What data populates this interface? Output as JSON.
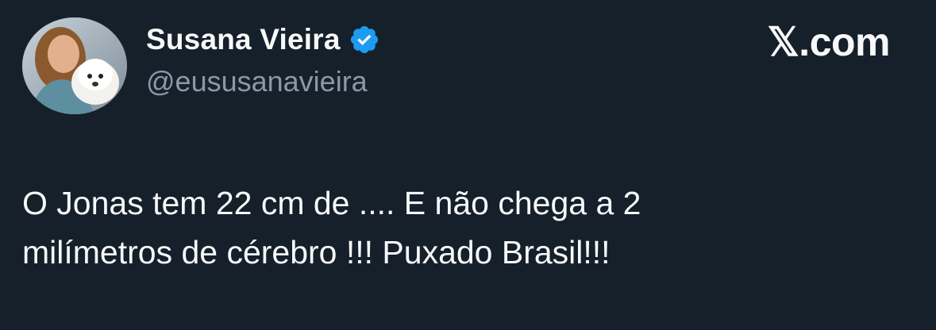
{
  "tweet": {
    "author": {
      "display_name": "Susana Vieira",
      "handle": "@eususanavieira",
      "verified": true,
      "avatar_icon": "profile-photo-with-dog"
    },
    "brand": "𝕏.com",
    "text_lines": [
      "O Jonas tem 22 cm de .... E não chega a 2",
      "milímetros de cérebro !!! Puxado Brasil!!!"
    ]
  },
  "colors": {
    "background": "#15202b",
    "text_primary": "#f7f9f9",
    "text_secondary": "#8b98a5",
    "verified_blue": "#1d9bf0"
  }
}
